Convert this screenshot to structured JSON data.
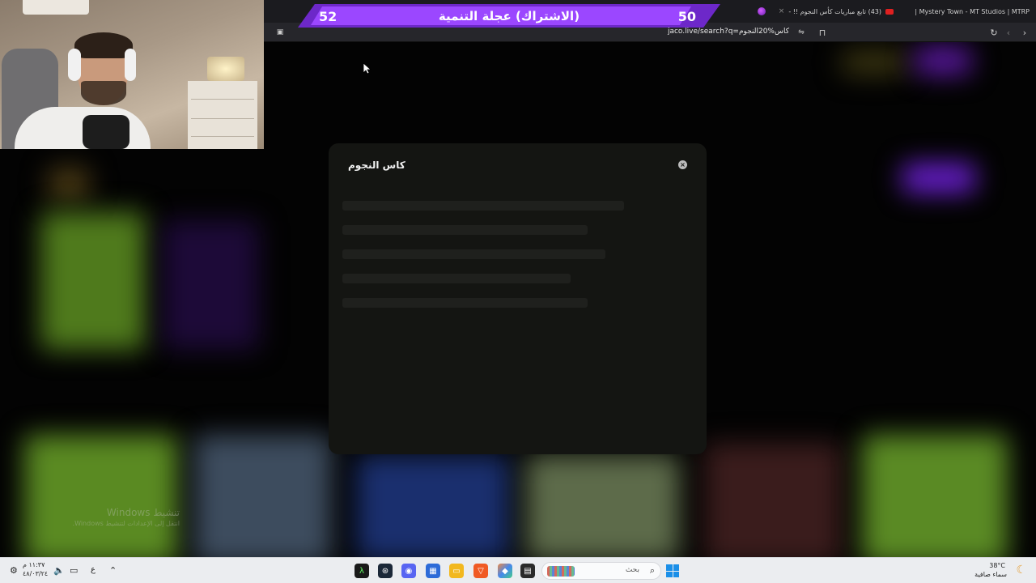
{
  "browser": {
    "tabs": [
      {
        "label": "Mystery Town - MT Studios | MTRP |"
      },
      {
        "label": "(43) تابع مباريات كأس النجوم !! -"
      }
    ],
    "url": "jaco.live/search?q=كاس%20النجوم"
  },
  "goal_overlay": {
    "title": "(الاشتراك) عجلة التنمية",
    "current": "50",
    "target": "52",
    "progress_fraction": 0.96,
    "color": "#7b2fe0"
  },
  "search_modal": {
    "title": "كاس النجوم",
    "close_icon": "close-icon"
  },
  "watermark": {
    "title": "تنشيط Windows",
    "subtitle": "انتقل إلى الإعدادات لتنشيط Windows."
  },
  "taskbar": {
    "weather_temp": "38°C",
    "weather_desc": "سماء صافية",
    "search_placeholder": "بحث",
    "clock_time": "١١:٣٧ م",
    "clock_date": "٤٨/٠٣/٢٤",
    "lang": "ع"
  }
}
